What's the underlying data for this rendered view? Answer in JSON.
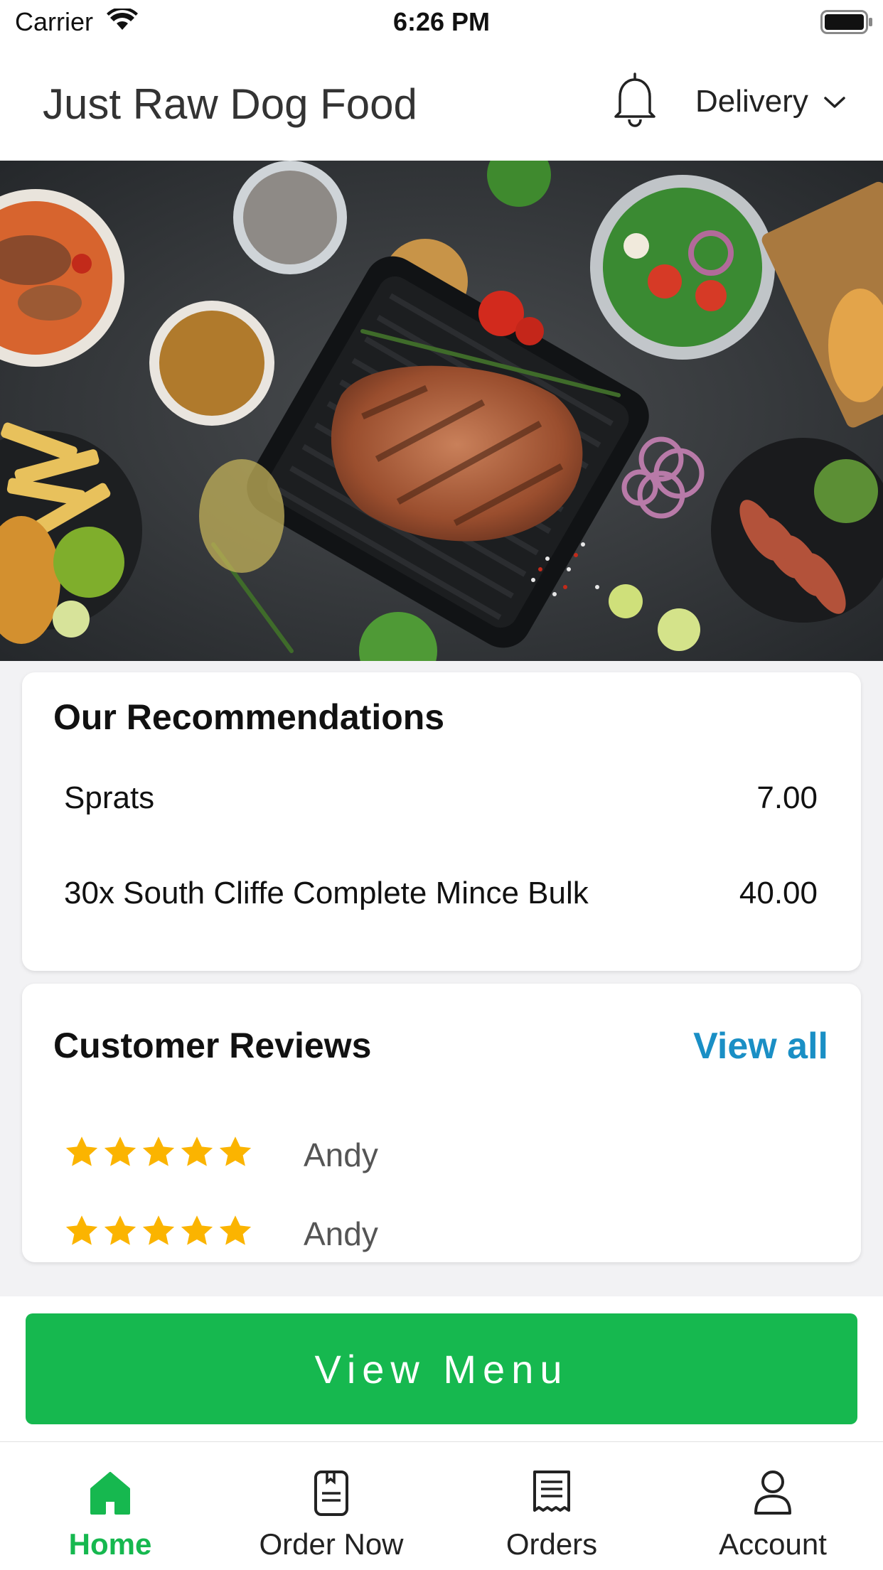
{
  "status_bar": {
    "carrier": "Carrier",
    "time": "6:26 PM"
  },
  "header": {
    "title": "Just Raw Dog Food",
    "delivery_label": "Delivery"
  },
  "recommendations": {
    "title": "Our Recommendations",
    "items": [
      {
        "name": "Sprats",
        "price": "7.00"
      },
      {
        "name": "30x South Cliffe Complete Mince Bulk",
        "price": "40.00"
      }
    ]
  },
  "reviews": {
    "title": "Customer Reviews",
    "view_all_label": "View all",
    "items": [
      {
        "name": "Andy",
        "rating": 5
      },
      {
        "name": "Andy",
        "rating": 5
      }
    ]
  },
  "view_menu_label": "View Menu",
  "tabs": [
    {
      "label": "Home",
      "icon": "home-icon",
      "active": true
    },
    {
      "label": "Order Now",
      "icon": "menu-book-icon",
      "active": false
    },
    {
      "label": "Orders",
      "icon": "receipt-icon",
      "active": false
    },
    {
      "label": "Account",
      "icon": "user-icon",
      "active": false
    }
  ],
  "colors": {
    "accent_green": "#16b84f",
    "link_blue": "#1a8fc5",
    "star_gold": "#fbb400"
  }
}
